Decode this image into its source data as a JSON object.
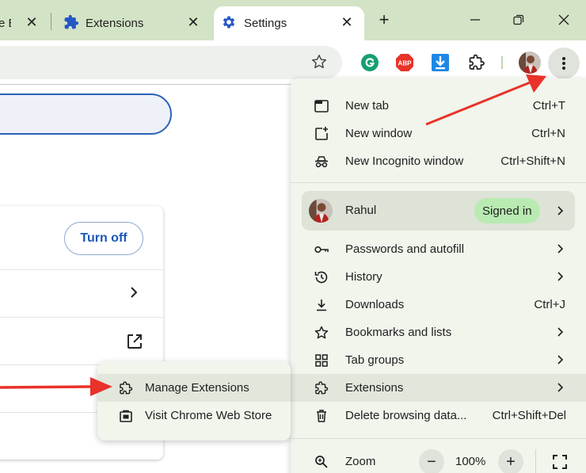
{
  "tabs": [
    {
      "title": "e B",
      "close": "✕"
    },
    {
      "title": "Extensions",
      "close": "✕"
    },
    {
      "title": "Settings",
      "close": "✕"
    }
  ],
  "new_tab_glyph": "+",
  "window_controls": {
    "minimize": "–",
    "restore": "❐",
    "close": "✕"
  },
  "toolbar": {
    "icons": [
      "bookmark-star-icon",
      "grammarly-icon",
      "adblock-plus-icon",
      "download-extension-icon",
      "extensions-puzzle-icon",
      "profile-avatar",
      "three-dot-menu-icon"
    ],
    "abp_label": "ABP"
  },
  "page": {
    "turn_off_label": "Turn off"
  },
  "menu": {
    "top_items": [
      {
        "label": "New tab",
        "shortcut": "Ctrl+T"
      },
      {
        "label": "New window",
        "shortcut": "Ctrl+N"
      },
      {
        "label": "New Incognito window",
        "shortcut": "Ctrl+Shift+N"
      }
    ],
    "profile": {
      "name": "Rahul",
      "status": "Signed in"
    },
    "items": [
      {
        "label": "Passwords and autofill",
        "shortcut": ""
      },
      {
        "label": "History",
        "shortcut": ""
      },
      {
        "label": "Downloads",
        "shortcut": "Ctrl+J"
      },
      {
        "label": "Bookmarks and lists",
        "shortcut": ""
      },
      {
        "label": "Tab groups",
        "shortcut": ""
      },
      {
        "label": "Extensions",
        "shortcut": ""
      },
      {
        "label": "Delete browsing data...",
        "shortcut": "Ctrl+Shift+Del"
      }
    ],
    "zoom": {
      "label": "Zoom",
      "value": "100%",
      "minus": "−",
      "plus": "+"
    }
  },
  "extensions_submenu": {
    "items": [
      {
        "label": "Manage Extensions"
      },
      {
        "label": "Visit Chrome Web Store"
      }
    ]
  },
  "colors": {
    "tabstrip": "#d3e3c5",
    "menu_bg": "#f1f5ec",
    "accent_blue": "#1a57b8",
    "signed_in_pill": "#b9eab2",
    "arrow_red": "#e8322a"
  }
}
